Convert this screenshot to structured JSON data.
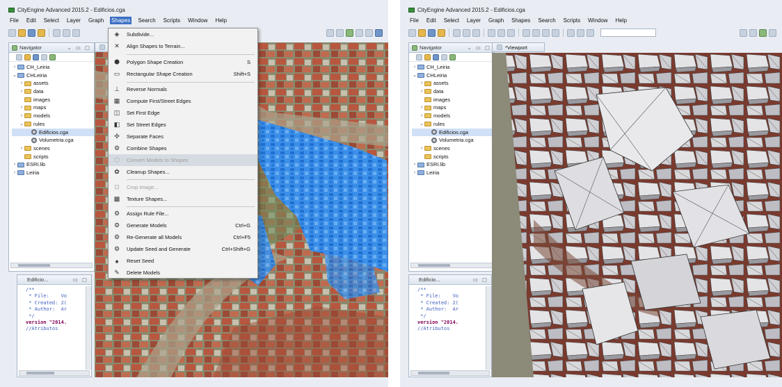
{
  "left_window": {
    "title": "CityEngine Advanced 2015.2 - Edificios.cga",
    "menu": [
      "File",
      "Edit",
      "Select",
      "Layer",
      "Graph",
      "Shapes",
      "Search",
      "Scripts",
      "Window",
      "Help"
    ],
    "navigator_tab": "Navigator",
    "tree": [
      "CH_Leiria",
      "CHLeiria",
      "assets",
      "data",
      "images",
      "maps",
      "models",
      "rules",
      "Edificios.cga",
      "Volumetria.cga",
      "scenes",
      "scripts",
      "ESRI.lib",
      "Leiria"
    ],
    "editor_tab": "Edificio...",
    "code": [
      "/**",
      " * File:    Vo",
      " * Created: 2(",
      " * Author:  Ar",
      " */",
      "",
      "version \"2014.",
      "",
      "//Atributos"
    ],
    "shapes_menu": [
      {
        "label": "Subdivide...",
        "shortcut": "",
        "icon": "subdivide-icon",
        "disabled": false
      },
      {
        "label": "Align Shapes to Terrain...",
        "shortcut": "",
        "icon": "align-icon",
        "disabled": false
      },
      {
        "label": "Polygon Shape Creation",
        "shortcut": "S",
        "icon": "polygon-icon",
        "disabled": false
      },
      {
        "label": "Rectangular Shape Creation",
        "shortcut": "Shift+S",
        "icon": "rectangle-icon",
        "disabled": false
      },
      {
        "label": "Reverse Normals",
        "shortcut": "",
        "icon": "normals-icon",
        "disabled": false
      },
      {
        "label": "Compute First/Street Edges",
        "shortcut": "",
        "icon": "edges-icon",
        "disabled": false
      },
      {
        "label": "Set First Edge",
        "shortcut": "",
        "icon": "first-edge-icon",
        "disabled": false
      },
      {
        "label": "Set Street Edges",
        "shortcut": "",
        "icon": "street-edge-icon",
        "disabled": false
      },
      {
        "label": "Separate Faces",
        "shortcut": "",
        "icon": "separate-icon",
        "disabled": false
      },
      {
        "label": "Combine Shapes",
        "shortcut": "",
        "icon": "combine-icon",
        "disabled": false
      },
      {
        "label": "Convert Models to Shapes",
        "shortcut": "",
        "icon": "convert-icon",
        "disabled": true
      },
      {
        "label": "Cleanup Shapes...",
        "shortcut": "",
        "icon": "cleanup-icon",
        "disabled": false
      },
      {
        "label": "Crop Image...",
        "shortcut": "",
        "icon": "crop-icon",
        "disabled": true
      },
      {
        "label": "Texture Shapes...",
        "shortcut": "",
        "icon": "texture-icon",
        "disabled": false
      },
      {
        "label": "Assign Rule File...",
        "shortcut": "",
        "icon": "rule-icon",
        "disabled": false
      },
      {
        "label": "Generate Models",
        "shortcut": "Ctrl+G",
        "icon": "generate-icon",
        "disabled": false
      },
      {
        "label": "Re-Generate all Models",
        "shortcut": "Ctrl+F5",
        "icon": "regenerate-icon",
        "disabled": false
      },
      {
        "label": "Update Seed and Generate",
        "shortcut": "Ctrl+Shift+G",
        "icon": "seed-generate-icon",
        "disabled": false
      },
      {
        "label": "Reset Seed",
        "shortcut": "",
        "icon": "reset-seed-icon",
        "disabled": false
      },
      {
        "label": "Delete Models",
        "shortcut": "",
        "icon": "delete-icon",
        "disabled": false
      }
    ]
  },
  "right_window": {
    "title": "CityEngine Advanced 2015.2 - Edificios.cga",
    "menu": [
      "File",
      "Edit",
      "Select",
      "Layer",
      "Graph",
      "Shapes",
      "Search",
      "Scripts",
      "Window",
      "Help"
    ],
    "navigator_tab": "Navigator",
    "viewport_tab": "*Viewport",
    "tree": [
      "CH_Leiria",
      "CHLeiria",
      "assets",
      "data",
      "images",
      "maps",
      "models",
      "rules",
      "Edificios.cga",
      "Volumetria.cga",
      "scenes",
      "scripts",
      "ESRI.lib",
      "Leiria"
    ],
    "editor_tab": "Edificio...",
    "code": [
      "/**",
      " * File:    Vo",
      " * Created: 2(",
      " * Author:  Ar",
      " */",
      "",
      "version \"2014.",
      "",
      "//Atributos"
    ]
  },
  "colors": {
    "menu_active": "#3b6fc4",
    "selected_shapes": "#2f86e6",
    "roof_tiles": "#b8573f",
    "model_gray": "#d9d9dc"
  }
}
